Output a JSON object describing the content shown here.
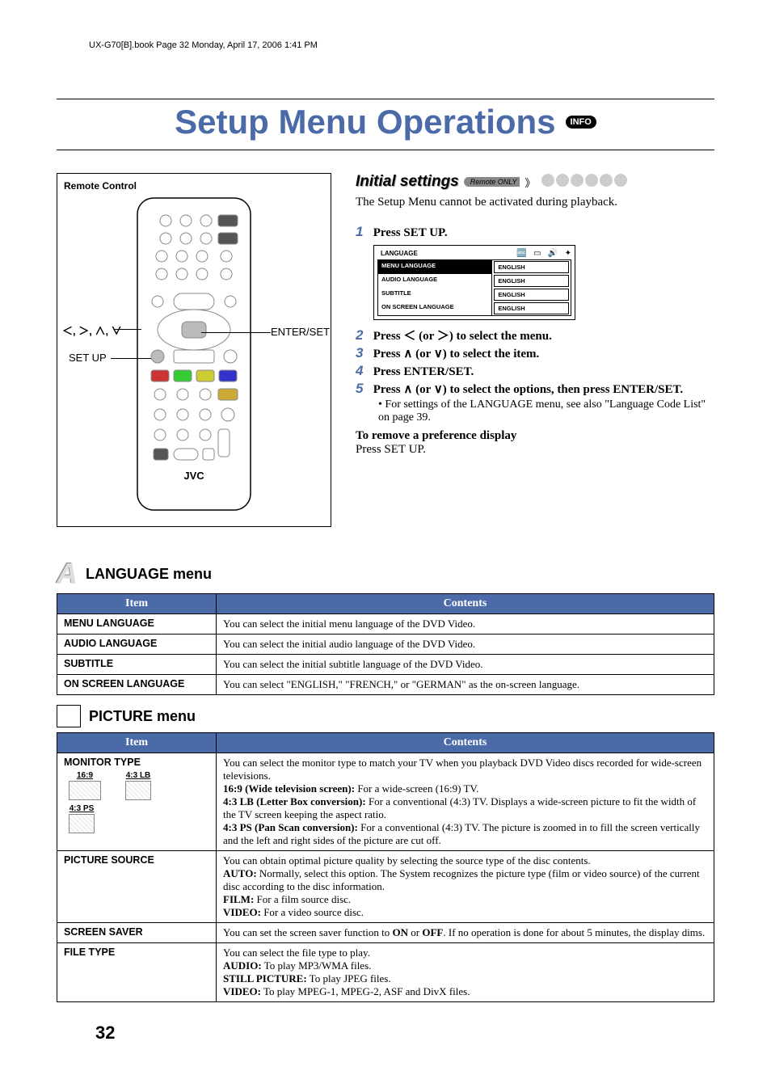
{
  "meta": {
    "header": "UX-G70[B].book  Page 32  Monday, April 17, 2006  1:41 PM"
  },
  "title": "Setup Menu Operations",
  "info_badge": "INFO",
  "rc": {
    "title": "Remote Control",
    "label_arrows": "＜, ＞, ∧, ∨",
    "label_setup": "SET UP",
    "label_enter": "ENTER/SET",
    "brand": "JVC"
  },
  "initial": {
    "heading": "Initial settings",
    "remote_only": "Remote ONLY",
    "intro": "The Setup Menu cannot be activated during playback.",
    "steps": {
      "s1": "Press SET UP.",
      "s2a": "Press ",
      "s2b": " (or ",
      "s2c": ") to select the menu.",
      "s3a": "Press ",
      "s3b": " (or ",
      "s3c": ") to select the item.",
      "s4": "Press ENTER/SET.",
      "s5a": "Press ",
      "s5b": " (or ",
      "s5c": ") to select the options, then press ENTER/SET.",
      "s5_note": "• For settings of the LANGUAGE menu, see also \"Language Code List\" on page 39."
    },
    "remove_hdr": "To remove a preference display",
    "remove_body": "Press SET UP."
  },
  "osd": {
    "title": "LANGUAGE",
    "rows": [
      {
        "k": "MENU LANGUAGE",
        "v": "ENGLISH"
      },
      {
        "k": "AUDIO LANGUAGE",
        "v": "ENGLISH"
      },
      {
        "k": "SUBTITLE",
        "v": "ENGLISH"
      },
      {
        "k": "ON SCREEN LANGUAGE",
        "v": "ENGLISH"
      }
    ]
  },
  "lang_menu": {
    "title": "LANGUAGE menu",
    "th_item": "Item",
    "th_contents": "Contents",
    "rows": [
      {
        "item": "MENU LANGUAGE",
        "contents": "You can select the initial menu language of the DVD Video."
      },
      {
        "item": "AUDIO LANGUAGE",
        "contents": "You can select the initial audio language of the DVD Video."
      },
      {
        "item": "SUBTITLE",
        "contents": "You can select the initial subtitle language of the DVD Video."
      },
      {
        "item": "ON SCREEN LANGUAGE",
        "contents": "You can select \"ENGLISH,\" \"FRENCH,\" or \"GERMAN\" as the on-screen language."
      }
    ]
  },
  "pic_menu": {
    "title": "PICTURE menu",
    "th_item": "Item",
    "th_contents": "Contents",
    "monitor": {
      "item": "MONITOR TYPE",
      "lbl_169": "16:9",
      "lbl_43lb": "4:3 LB",
      "lbl_43ps": "4:3 PS",
      "c1": "You can select the monitor type to match your TV when you playback DVD Video discs recorded for wide-screen televisions.",
      "c2a": "16:9 (Wide television screen):",
      "c2b": " For a wide-screen (16:9) TV.",
      "c3a": "4:3 LB (Letter Box conversion):",
      "c3b": " For a conventional (4:3) TV. Displays a wide-screen picture to fit the width of the TV screen keeping the aspect ratio.",
      "c4a": "4:3 PS (Pan Scan conversion):",
      "c4b": " For a conventional (4:3) TV. The picture is zoomed in to fill the screen vertically and the left and right sides of the picture are cut off."
    },
    "source": {
      "item": "PICTURE SOURCE",
      "c1": "You can obtain optimal picture quality by selecting the source type of the disc contents.",
      "c2a": "AUTO:",
      "c2b": " Normally, select this option. The System recognizes the picture type (film or video source) of the current disc according to the disc information.",
      "c3a": "FILM:",
      "c3b": " For a film source disc.",
      "c4a": "VIDEO:",
      "c4b": " For a video source disc."
    },
    "saver": {
      "item": "SCREEN SAVER",
      "c1a": "You can set the screen saver function to ",
      "c1b": "ON",
      "c1c": " or ",
      "c1d": "OFF",
      "c1e": ". If no operation is done for about 5 minutes, the display dims."
    },
    "file": {
      "item": "FILE TYPE",
      "c1": "You can select the file type to play.",
      "c2a": "AUDIO:",
      "c2b": " To play MP3/WMA files.",
      "c3a": "STILL PICTURE:",
      "c3b": " To play JPEG files.",
      "c4a": "VIDEO:",
      "c4b": " To play MPEG-1, MPEG-2, ASF and DivX files."
    }
  },
  "page_num": "32"
}
